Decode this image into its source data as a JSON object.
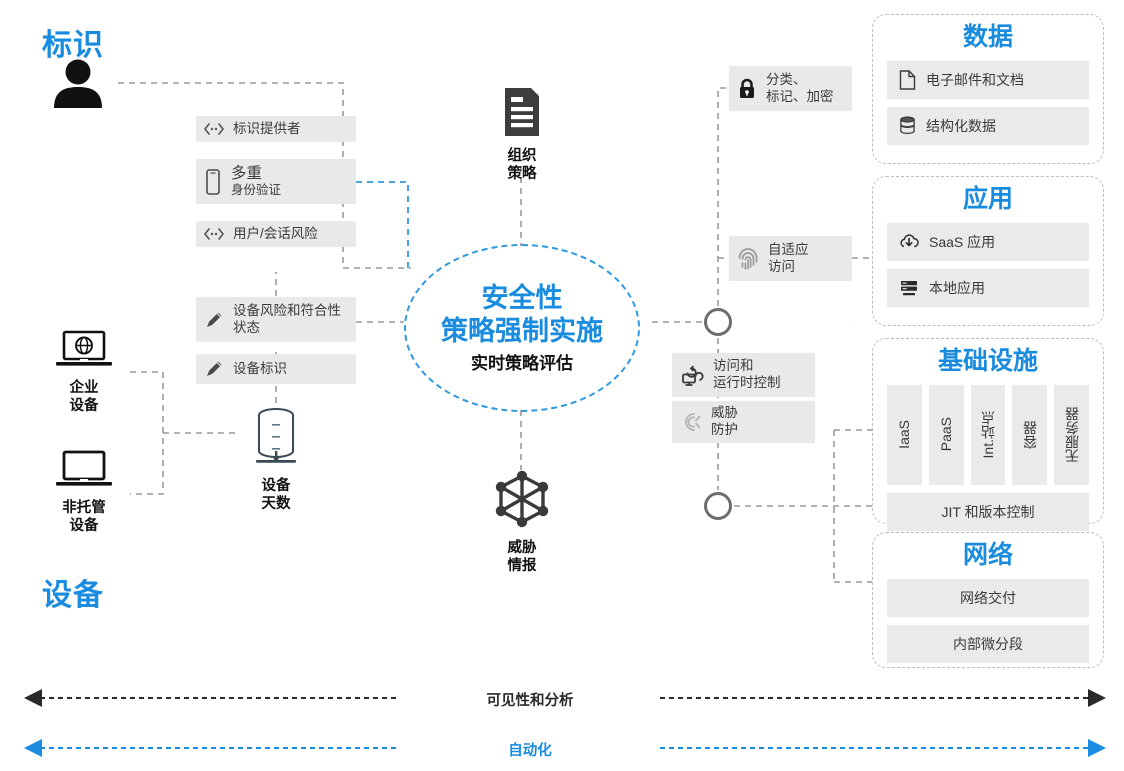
{
  "theme": {
    "accent_blue": "#1a8cdf",
    "ellipse_blue": "#2f9ae0",
    "chip_gray": "#e9e9e9",
    "panel_border_gray": "#bdbdbd",
    "connector_gray": "#8c8c8c",
    "text_dark": "#3b3b3b"
  },
  "identity": {
    "section_title": "标识",
    "user_icon": "person-icon",
    "chips": [
      {
        "icon": "connector-icon",
        "label": "标识提供者",
        "sub": ""
      },
      {
        "icon": "mobile-device-icon",
        "label": "多重",
        "sub": "身份验证"
      },
      {
        "icon": "connector-icon",
        "label": "用户/会话风险",
        "sub": ""
      }
    ]
  },
  "devices": {
    "section_title": "设备",
    "endpoints": [
      {
        "icon": "corporate-laptop-globe-icon",
        "label": "企业\n设备"
      },
      {
        "icon": "unmanaged-laptop-icon",
        "label": "非托管\n设备"
      }
    ],
    "chips": [
      {
        "icon": "pencil-icon",
        "label": "设备风险和符合性",
        "sub": "状态"
      },
      {
        "icon": "pencil-icon",
        "label": "设备标识",
        "sub": ""
      }
    ],
    "inventory": {
      "icon": "database-icon",
      "label": "设备\n天数"
    }
  },
  "center": {
    "org_policy": {
      "icon": "document-policy-icon",
      "label": "组织\n策略"
    },
    "ellipse": {
      "line1": "安全性",
      "line2": "策略强制实施",
      "line3": "实时策略评估"
    },
    "threat_intel": {
      "icon": "threat-graph-icon",
      "label": "威胁\n情报"
    }
  },
  "controls": {
    "chips": [
      {
        "icon": "lock-icon",
        "label": "分类、",
        "sub": "标记、加密"
      },
      {
        "icon": "fingerprint-icon",
        "label": "自适应",
        "sub": "访问"
      },
      {
        "icon": "runtime-control-icon",
        "label": "访问和",
        "sub": "运行时控制"
      },
      {
        "icon": "shield-threat-icon",
        "label": "威胁",
        "sub": "防护"
      }
    ],
    "junction_nodes": [
      {
        "name": "junction-node-upper"
      },
      {
        "name": "junction-node-lower"
      }
    ]
  },
  "pillars": [
    {
      "id": "data",
      "title": "数据",
      "rows": [
        {
          "icon": "file-document-icon",
          "label": "电子邮件和文档"
        },
        {
          "icon": "database-stack-icon",
          "label": "结构化数据"
        }
      ]
    },
    {
      "id": "apps",
      "title": "应用",
      "rows": [
        {
          "icon": "cloud-download-icon",
          "label": "SaaS 应用"
        },
        {
          "icon": "server-rack-icon",
          "label": "本地应用"
        }
      ]
    },
    {
      "id": "infrastructure",
      "title": "基础设施",
      "vertical_items": [
        "IaaS",
        "PaaS",
        "Int.站点",
        "容器",
        "无服务器"
      ],
      "rows": [
        {
          "icon": "",
          "label": "JIT 和版本控制"
        }
      ]
    },
    {
      "id": "network",
      "title": "网络",
      "rows": [
        {
          "icon": "",
          "label": "网络交付"
        },
        {
          "icon": "",
          "label": "内部微分段"
        }
      ]
    }
  ],
  "bottom_arrows": [
    {
      "label": "可见性和分析",
      "color": "#2a2a2a"
    },
    {
      "label": "自动化",
      "color": "#1a8cdf"
    }
  ]
}
